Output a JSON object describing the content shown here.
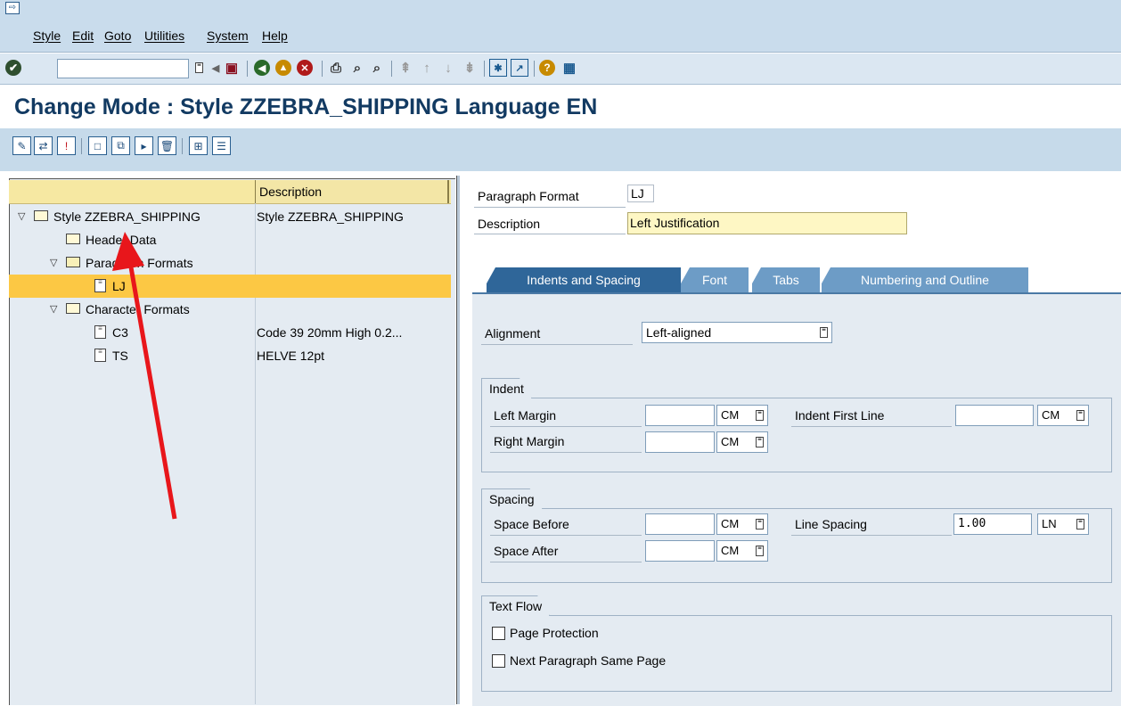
{
  "menu": [
    "Style",
    "Edit",
    "Goto",
    "Utilities",
    "System",
    "Help"
  ],
  "title": "Change Mode : Style ZZEBRA_SHIPPING Language EN",
  "tree": {
    "header_description": "Description",
    "rows": [
      {
        "label": "Style ZZEBRA_SHIPPING",
        "desc": "Style ZZEBRA_SHIPPING"
      },
      {
        "label": "Header Data",
        "desc": ""
      },
      {
        "label": "Paragraph Formats",
        "desc": ""
      },
      {
        "label": "LJ",
        "desc": ""
      },
      {
        "label": "Character Formats",
        "desc": ""
      },
      {
        "label": "C3",
        "desc": "Code 39 20mm High 0.2..."
      },
      {
        "label": "TS",
        "desc": "HELVE 12pt"
      }
    ]
  },
  "form": {
    "paragraph_format_label": "Paragraph Format",
    "paragraph_format_value": "LJ",
    "description_label": "Description",
    "description_value": "Left Justification"
  },
  "tabs": [
    "Indents and Spacing",
    "Font",
    "Tabs",
    "Numbering and Outline"
  ],
  "alignment": {
    "label": "Alignment",
    "value": "Left-aligned"
  },
  "indent": {
    "title": "Indent",
    "left_margin": "Left Margin",
    "right_margin": "Right Margin",
    "indent_first_line": "Indent First Line",
    "unit": "CM"
  },
  "spacing": {
    "title": "Spacing",
    "space_before": "Space Before",
    "space_after": "Space After",
    "line_spacing": "Line Spacing",
    "line_spacing_value": "1.00",
    "line_unit": "LN",
    "unit": "CM"
  },
  "textflow": {
    "title": "Text Flow",
    "page_protection": "Page Protection",
    "next_paragraph": "Next Paragraph Same Page"
  },
  "colors": {
    "selected_row": "#fcc844",
    "title": "#123a62",
    "tab_active": "#2f6699",
    "tab": "#6d9cc6",
    "arrow": "#e8161b"
  }
}
